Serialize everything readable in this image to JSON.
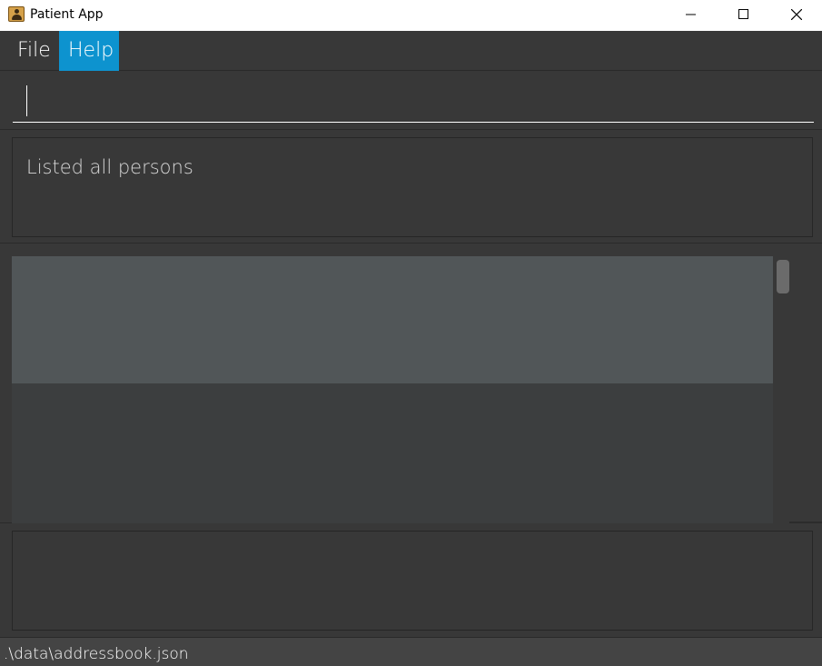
{
  "window": {
    "title": "Patient App",
    "icons": [
      "address-book-icon",
      "minimize-icon",
      "maximize-icon",
      "close-icon"
    ]
  },
  "menu": {
    "items": [
      {
        "label": "File",
        "active": false
      },
      {
        "label": "Help",
        "active": true
      }
    ],
    "accent_color": "#0d93cf"
  },
  "command_box": {
    "value": "",
    "placeholder": ""
  },
  "result_display": {
    "message": "Listed all persons"
  },
  "person_list": {
    "rows": [
      {
        "selected": true
      }
    ]
  },
  "status_bar": {
    "save_location": ".\\data\\addressbook.json"
  },
  "colors": {
    "background": "#383838",
    "selected_row": "#515658",
    "panel": "#3c3e3f"
  }
}
